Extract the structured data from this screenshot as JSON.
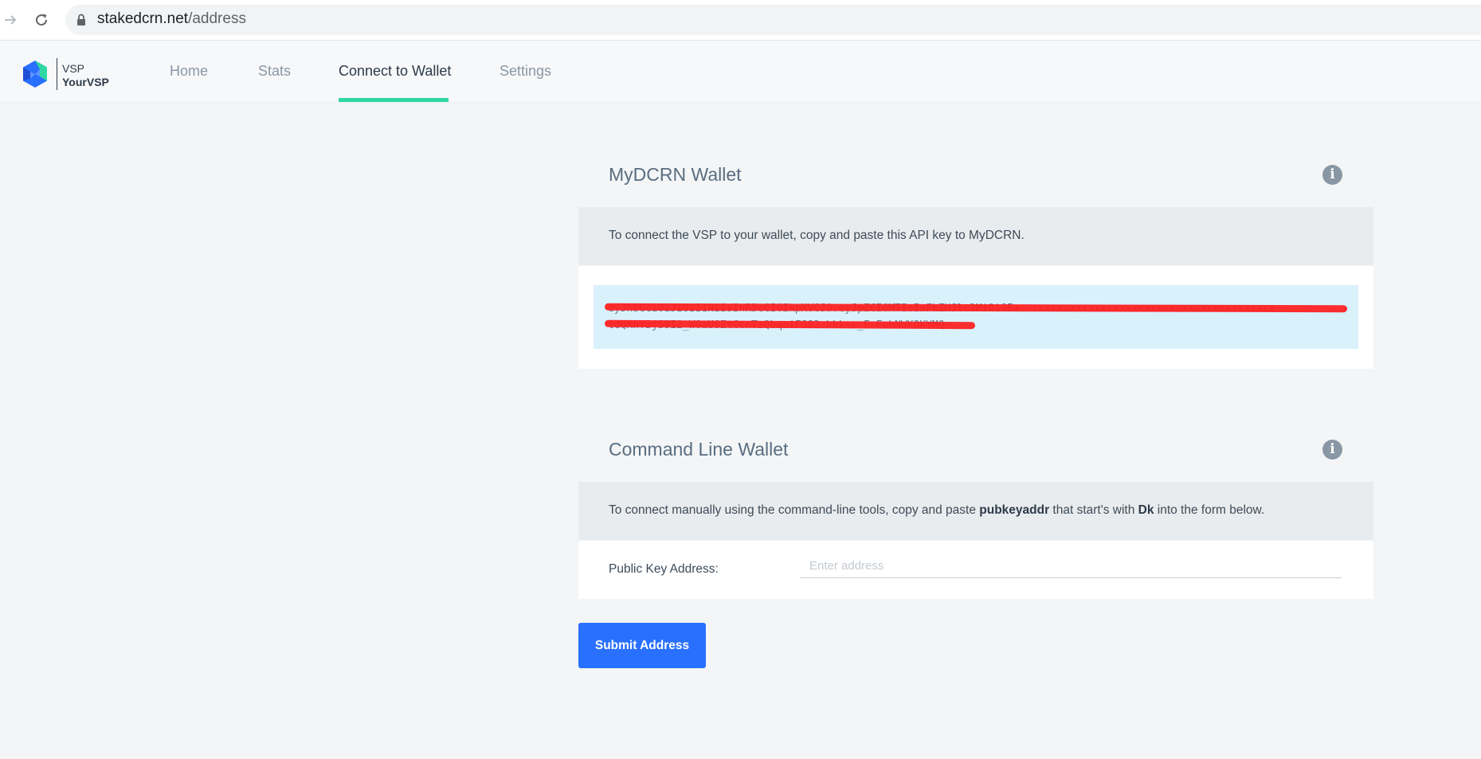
{
  "browser": {
    "url_host": "stakedcrn.net",
    "url_path": "/address"
  },
  "header": {
    "logo_small": "VSP",
    "logo_name": "YourVSP",
    "nav": [
      {
        "label": "Home",
        "active": false
      },
      {
        "label": "Stats",
        "active": false
      },
      {
        "label": "Connect to Wallet",
        "active": true
      },
      {
        "label": "Settings",
        "active": false
      }
    ]
  },
  "mydcrn": {
    "title": "MyDCRN Wallet",
    "description": "To connect the VSP to your wallet, copy and paste this API key to MyDCRN.",
    "api_key_line1": "eyJhbGciOiJIUzI1NiIsInR5cCI6IkpXVCJ9.eyJpZCI6MTIsImFkZHJlc3MiOiJEa...xxxxxxxxxxxxxxxxxxxxxxxxxxxxxxxxxxxxxx",
    "api_key_line2": "tdQXhY3jS9I2_WOaUSZtCcnTzQbqaiFS82-hkkse_F-FehNWKOKYMQ",
    "api_key_redacted": true
  },
  "cli": {
    "title": "Command Line Wallet",
    "description_before": "To connect manually using the command-line tools, copy and paste ",
    "description_bold1": "pubkeyaddr",
    "description_middle": " that start's with ",
    "description_bold2": "Dk",
    "description_after": " into the form below.",
    "field_label": "Public Key Address:",
    "field_placeholder": "Enter address",
    "field_value": ""
  },
  "submit_label": "Submit Address",
  "colors": {
    "accent_underline": "#2ed8a3",
    "primary_button": "#2970ff",
    "api_box_bg": "#d9f1fb",
    "redaction": "#ff1c1c"
  }
}
